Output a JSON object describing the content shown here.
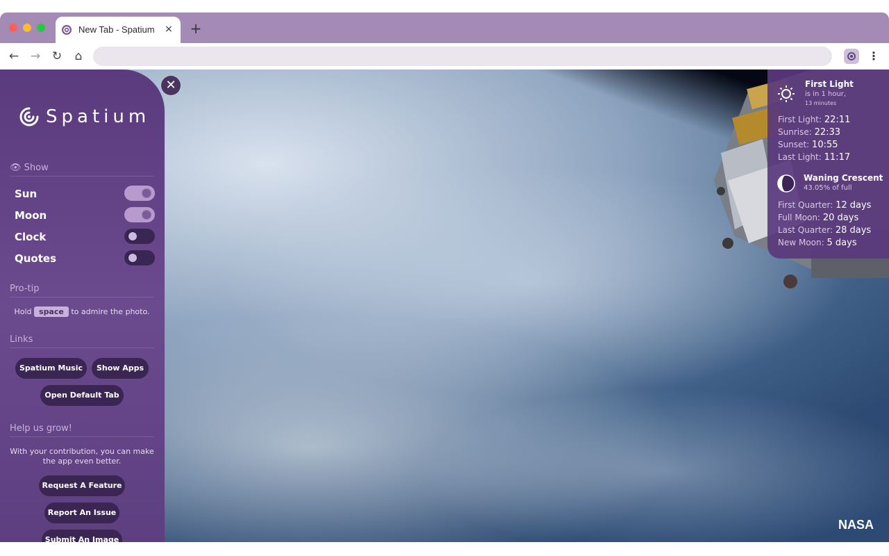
{
  "browser": {
    "tab_title": "New Tab - Spatium",
    "tab_close": "×",
    "new_tab": "+",
    "back": "←",
    "forward": "→",
    "reload": "↻",
    "home": "⌂",
    "menu": "⋮"
  },
  "sidebar": {
    "close": "✕",
    "logo_text": "Spatium",
    "show_title": "Show",
    "toggles": [
      {
        "label": "Sun",
        "on": true
      },
      {
        "label": "Moon",
        "on": true
      },
      {
        "label": "Clock",
        "on": false
      },
      {
        "label": "Quotes",
        "on": false
      }
    ],
    "protip_title": "Pro-tip",
    "protip_before": "Hold",
    "protip_key": "space",
    "protip_after": "to admire the photo.",
    "links_title": "Links",
    "links": [
      "Spatium Music",
      "Show Apps",
      "Open Default Tab"
    ],
    "help_title": "Help us grow!",
    "help_text": "With your contribution, you can make the app even better.",
    "help_buttons": [
      "Request A Feature",
      "Report An Issue",
      "Submit An Image"
    ]
  },
  "widget": {
    "sun_title": "First Light",
    "sun_sub": "is in 1 hour,",
    "sun_sub2": "13 minutes",
    "sun_lines": [
      {
        "label": "First Light:",
        "value": "22:11"
      },
      {
        "label": "Sunrise:",
        "value": "22:33"
      },
      {
        "label": "Sunset:",
        "value": "10:55"
      },
      {
        "label": "Last Light:",
        "value": "11:17"
      }
    ],
    "moon_title": "Waning Crescent",
    "moon_sub": "43.05% of full",
    "moon_lines": [
      {
        "label": "First Quarter:",
        "value": "12 days"
      },
      {
        "label": "Full Moon:",
        "value": "20 days"
      },
      {
        "label": "Last Quarter:",
        "value": "28 days"
      },
      {
        "label": "New Moon:",
        "value": "5 days"
      }
    ]
  },
  "photo_credit": "NASA",
  "colors": {
    "accent": "#a38bb5",
    "sidebar": "#5a3b7d",
    "pill": "#3b2553"
  }
}
